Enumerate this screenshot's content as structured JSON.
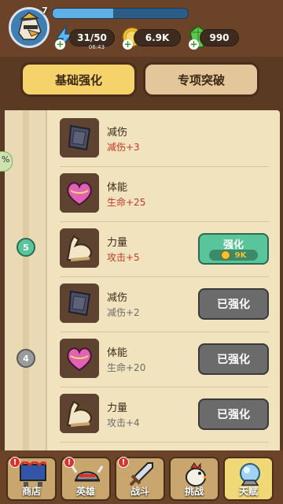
{
  "player": {
    "level": "7",
    "xp_fraction": 0.45
  },
  "resources": {
    "energy": "31/50",
    "energy_timer": "06:43",
    "coins": "6.9K",
    "gems": "990"
  },
  "tabs": {
    "basic": "基础强化",
    "special": "专项突破"
  },
  "nodes": {
    "n5": "5",
    "n4": "4"
  },
  "rows": [
    {
      "title": "减伤",
      "stat": "减伤+3",
      "stat_color": "#c0392b",
      "icon": "shield-icon",
      "state": "none"
    },
    {
      "title": "体能",
      "stat": "生命+25",
      "stat_color": "#c0392b",
      "icon": "heart-icon",
      "state": "none"
    },
    {
      "title": "力量",
      "stat": "攻击+5",
      "stat_color": "#c0392b",
      "icon": "muscle-icon",
      "state": "upgrade",
      "button_label": "强化",
      "cost": "9K"
    },
    {
      "title": "减伤",
      "stat": "减伤+2",
      "stat_color": "#6b6b6b",
      "icon": "shield-icon",
      "state": "done",
      "button_label": "已强化"
    },
    {
      "title": "体能",
      "stat": "生命+20",
      "stat_color": "#6b6b6b",
      "icon": "heart-icon",
      "state": "done",
      "button_label": "已强化"
    },
    {
      "title": "力量",
      "stat": "攻击+4",
      "stat_color": "#6b6b6b",
      "icon": "muscle-icon",
      "state": "done",
      "button_label": "已强化"
    }
  ],
  "nav": [
    {
      "label": "商店",
      "icon": "shop-icon",
      "alert": "!"
    },
    {
      "label": "英雄",
      "icon": "helmet-icon",
      "alert": "!"
    },
    {
      "label": "战斗",
      "icon": "sword-icon",
      "alert": "!"
    },
    {
      "label": "挑战",
      "icon": "chicken-icon",
      "alert": ""
    },
    {
      "label": "天赋",
      "icon": "talent-orb-icon",
      "alert": ""
    }
  ],
  "colors": {
    "upgrade": "#5ac59a",
    "done": "#6b6b6b",
    "accent_tab": "#f5d36a"
  }
}
